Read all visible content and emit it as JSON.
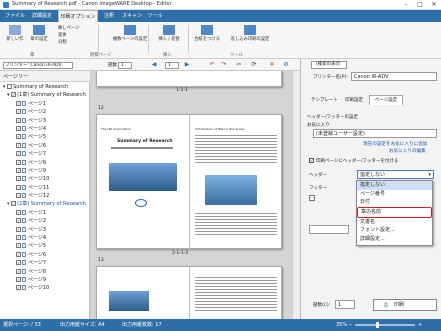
{
  "window": {
    "title": "Summary of Research.pdf - Canon imageWARE Desktop - Editor"
  },
  "menu": {
    "tabs": [
      "ファイル",
      "詳細設定",
      "印刷オプション",
      "注釈",
      "スキャン",
      "ツール"
    ],
    "active": "印刷オプション"
  },
  "ribbon": {
    "buttons": [
      {
        "label": "新しい作",
        "icon": "new-icon",
        "color": "#8aa9d6"
      },
      {
        "label": "章の設定",
        "icon": "chapter-icon",
        "color": "#4f86c6"
      },
      {
        "label": "複数ページの設定",
        "icon": "multipage-icon",
        "color": "#4f86c6"
      },
      {
        "label": "挿入 / 差替",
        "icon": "insert-icon",
        "color": "#4f86c6"
      },
      {
        "label": "合紙をつける",
        "icon": "slip-sheet-icon",
        "color": "#4f86c6"
      },
      {
        "label": "差し込み印刷の設定",
        "icon": "merge-print-icon",
        "color": "#4f86c6"
      }
    ],
    "small_items": [
      "挿しページ",
      "実体",
      "分割"
    ],
    "groups": [
      "章",
      "原稿ページ",
      "挿入",
      "ツール"
    ]
  },
  "toolbar2": {
    "printer_label": "プリンター: Canon iR-ADV",
    "copies_label": "部数",
    "copies_value": "1",
    "page_value": "1"
  },
  "leftpanel": {
    "title": "ページリー",
    "root": "Summary of Research",
    "chapter1": "(1章) Summary of Research",
    "chapter2": "(2章) Summary of Research",
    "pages1": [
      "ページ1",
      "ページ2",
      "ページ3",
      "ページ4",
      "ページ5",
      "ページ6",
      "ページ7",
      "ページ8",
      "ページ9",
      "ページ10",
      "ページ11",
      "ページ12"
    ],
    "pages2": [
      "ページ1",
      "ページ2",
      "ページ3",
      "ページ4",
      "ページ5",
      "ページ6",
      "ページ7",
      "ページ8",
      "ページ9",
      "ページ10"
    ]
  },
  "docarea": {
    "page_label_top": "1-1-1",
    "sheet_number": "12",
    "sheet_label": "2-1-1-2",
    "lower_sheet_number": "13",
    "page_left_heading": "The I30 Corporation",
    "page_left_title": "Summary of Research",
    "page_right_heading": "Introduction of R&D in the Group"
  },
  "rightpanel": {
    "search_label": "(検索の表示",
    "printer_label": "プリンター名(P):",
    "printer_value": "Canon iR-ADV",
    "tabs": [
      "テンプレート",
      "印刷設定",
      "ページ設定"
    ],
    "header_footer_label": "ヘッダー/フッターの設定",
    "fav_label": "お気に入り",
    "fav_value": "(未登録ユーザー設定)",
    "link1": "現在の設定をお気に入りに追加",
    "link2": "お気に入りの編集",
    "checkbox_label": "印刷ページにヘッダー/フッターを付ける",
    "header_label": "ヘッダー",
    "header_value": "指定しない",
    "footer_label": "フッター",
    "copies_label": "部数(C):",
    "copies_value": "1",
    "print_button": "印刷"
  },
  "dropdown": {
    "items": [
      "指定しない",
      "ページ番号",
      "日付",
      "章の名前",
      "文書名",
      "フォント設定...",
      "詳細設定..."
    ],
    "selected": "章の名前"
  },
  "status": {
    "pages": "選択ページ: / 33",
    "size": "出力用紙サイズ: A4",
    "sheets": "出力用紙枚数: 17",
    "zoom": "35%"
  }
}
